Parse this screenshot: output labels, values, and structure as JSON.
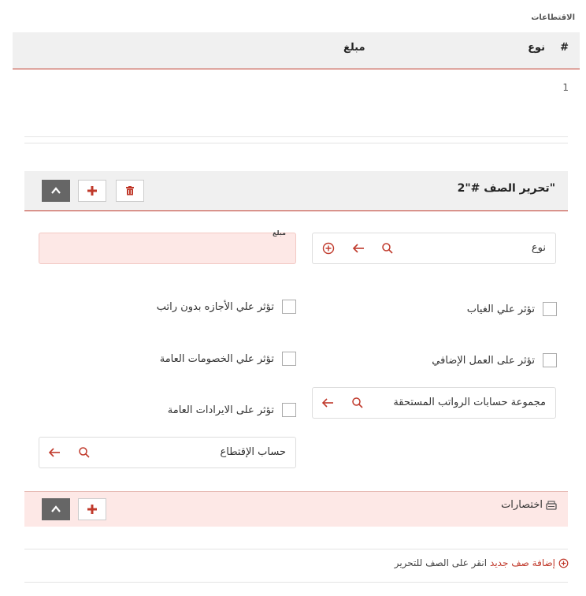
{
  "deductions": {
    "section_title": "الاقتطاعات",
    "columns": {
      "index": "#",
      "type": "نوع",
      "amount": "مبلغ"
    },
    "rows": [
      {
        "index": "1"
      }
    ]
  },
  "editor": {
    "title": "\"تحرير الصف #\"2",
    "type_field": {
      "value": "نوع"
    },
    "amount_field": {
      "label": "مبلغ",
      "value": ""
    },
    "checkboxes": {
      "absence": "تؤثر علي الغياب",
      "unpaid_leave": "تؤثر علي الأجازه بدون راتب",
      "overtime": "تؤثر على العمل الإضافي",
      "general_deductions": "تؤثر علي الخصومات العامة",
      "general_revenues": "تؤثر على الايرادات العامة"
    },
    "salary_accounts_group": {
      "value": "مجموعة حسابات الرواتب المستحقة"
    },
    "deduction_account": {
      "value": "حساب الإقتطاع"
    }
  },
  "shortcuts": {
    "title": "اختصارات"
  },
  "footer": {
    "add_row": "إضافة صف جديد",
    "hint": "انقر على الصف للتحرير"
  },
  "colors": {
    "accent": "#c0392b",
    "pink": "#fde8e6",
    "header_bg": "#f0f0f0"
  }
}
